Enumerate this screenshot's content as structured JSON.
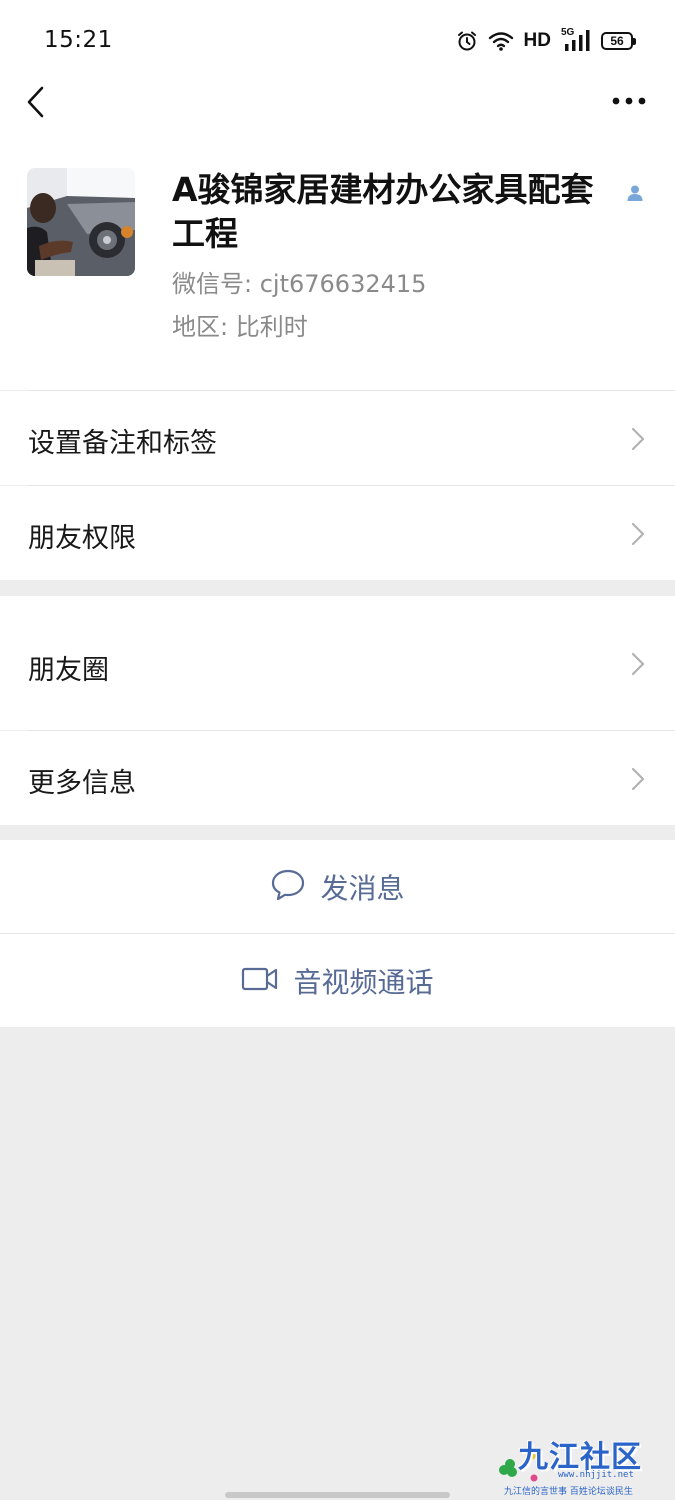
{
  "status_bar": {
    "time": "15:21",
    "network": "HD",
    "signal": "5G",
    "battery": "56",
    "icons": [
      "alarm-icon",
      "wifi-icon",
      "signal-icon",
      "battery-icon"
    ]
  },
  "nav": {
    "back_icon": "chevron-left-icon",
    "more_icon": "more-dots-icon"
  },
  "profile": {
    "name": "A骏锦家居建材办公家具配套工程",
    "wechat_id": "微信号: cjt676632415",
    "region": "地区: 比利时"
  },
  "rows": {
    "remark_tags": "设置备注和标签",
    "friend_permission": "朋友权限",
    "moments": "朋友圈",
    "more_info": "更多信息"
  },
  "actions": {
    "send_message": "发消息",
    "av_call": "音视频通话"
  },
  "watermark": {
    "title": "九江社区",
    "url": "www.nhjjit.net",
    "slogan": "九江信的言世事   百姓论坛谈民生"
  },
  "colors": {
    "link": "#576b95",
    "background": "#ededed",
    "card": "#ffffff",
    "secondary_text": "#8a8a8a"
  }
}
